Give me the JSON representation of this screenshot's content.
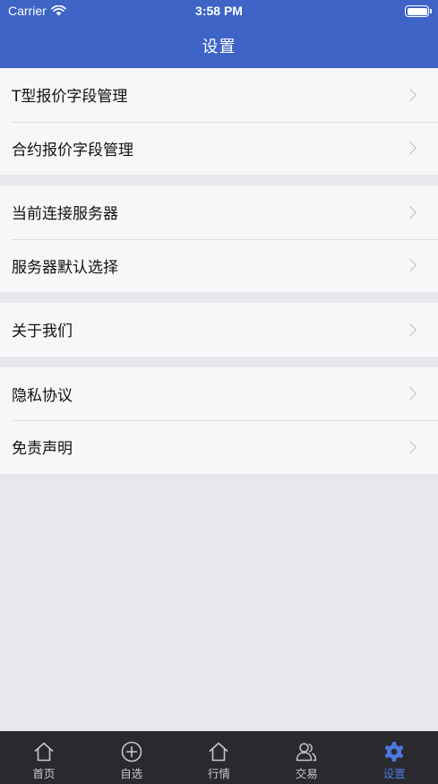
{
  "status_bar": {
    "carrier": "Carrier",
    "time": "3:58 PM"
  },
  "header": {
    "title": "设置"
  },
  "groups": [
    {
      "items": [
        {
          "label": "T型报价字段管理"
        },
        {
          "label": "合约报价字段管理"
        }
      ]
    },
    {
      "items": [
        {
          "label": "当前连接服务器"
        },
        {
          "label": "服务器默认选择"
        }
      ]
    },
    {
      "items": [
        {
          "label": "关于我们"
        }
      ]
    },
    {
      "items": [
        {
          "label": "隐私协议"
        },
        {
          "label": "免责声明"
        }
      ]
    }
  ],
  "tabbar": {
    "items": [
      {
        "label": "首页",
        "icon": "home-icon"
      },
      {
        "label": "自选",
        "icon": "plus-circle-icon"
      },
      {
        "label": "行情",
        "icon": "house-icon"
      },
      {
        "label": "交易",
        "icon": "users-icon"
      },
      {
        "label": "设置",
        "icon": "gear-icon"
      }
    ],
    "active_index": 4
  },
  "colors": {
    "header_bg": "#3d64c6",
    "tabbar_bg": "#2a2a2e",
    "tab_active": "#4e78de",
    "page_bg": "#e7e7ec"
  }
}
